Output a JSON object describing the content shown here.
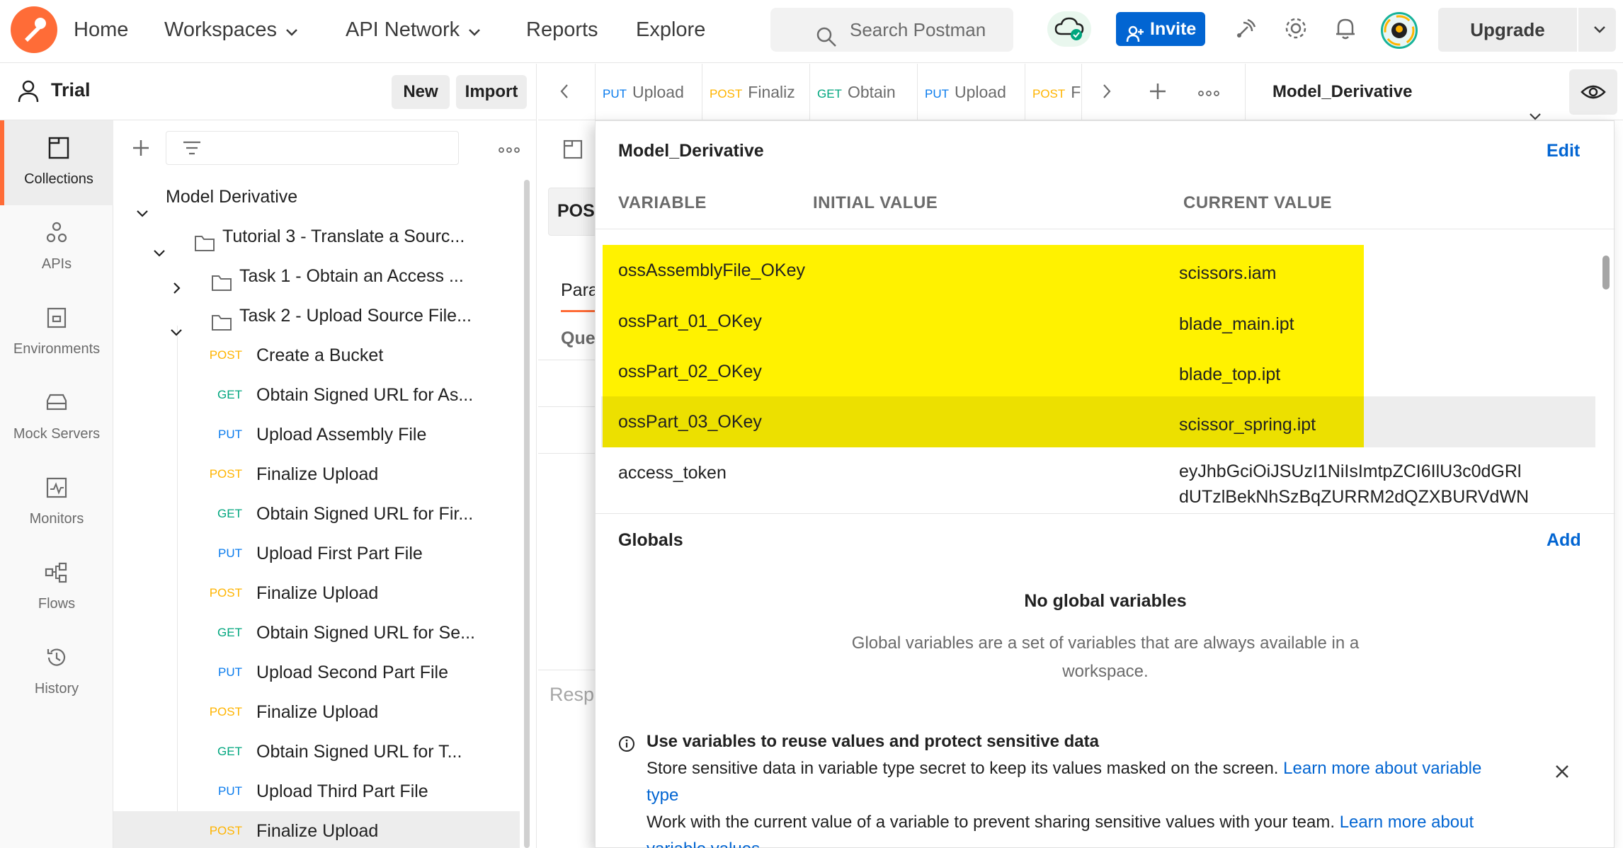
{
  "topbar": {
    "nav": [
      {
        "label": "Home",
        "has_menu": false
      },
      {
        "label": "Workspaces",
        "has_menu": true
      },
      {
        "label": "API Network",
        "has_menu": true
      },
      {
        "label": "Reports",
        "has_menu": false
      },
      {
        "label": "Explore",
        "has_menu": false
      }
    ],
    "search_placeholder": "Search Postman",
    "invite_label": "Invite",
    "upgrade_label": "Upgrade",
    "accent_color": "#ff6c37",
    "primary_color": "#0265d2"
  },
  "workspace": {
    "name": "Trial",
    "new_label": "New",
    "import_label": "Import"
  },
  "rail": [
    {
      "label": "Collections",
      "icon": "collections-icon",
      "active": true
    },
    {
      "label": "APIs",
      "icon": "apis-icon",
      "active": false
    },
    {
      "label": "Environments",
      "icon": "environments-icon",
      "active": false
    },
    {
      "label": "Mock Servers",
      "icon": "mock-servers-icon",
      "active": false
    },
    {
      "label": "Monitors",
      "icon": "monitors-icon",
      "active": false
    },
    {
      "label": "Flows",
      "icon": "flows-icon",
      "active": false
    },
    {
      "label": "History",
      "icon": "history-icon",
      "active": false
    }
  ],
  "tree": {
    "collection": "Model Derivative",
    "folder": "Tutorial 3 - Translate a Sourc...",
    "task1": "Task 1 - Obtain an Access ...",
    "task2": "Task 2 - Upload Source File...",
    "requests": [
      {
        "method": "POST",
        "name": "Create a Bucket"
      },
      {
        "method": "GET",
        "name": "Obtain Signed URL for As..."
      },
      {
        "method": "PUT",
        "name": "Upload Assembly File"
      },
      {
        "method": "POST",
        "name": "Finalize Upload"
      },
      {
        "method": "GET",
        "name": "Obtain Signed URL for Fir..."
      },
      {
        "method": "PUT",
        "name": "Upload First Part File"
      },
      {
        "method": "POST",
        "name": "Finalize Upload"
      },
      {
        "method": "GET",
        "name": "Obtain Signed URL for Se..."
      },
      {
        "method": "PUT",
        "name": "Upload Second Part File"
      },
      {
        "method": "POST",
        "name": "Finalize Upload"
      },
      {
        "method": "GET",
        "name": "Obtain Signed URL for T..."
      },
      {
        "method": "PUT",
        "name": "Upload Third Part File"
      },
      {
        "method": "POST",
        "name": "Finalize Upload"
      }
    ]
  },
  "tabs": [
    {
      "method": "PUT",
      "name": "Upload"
    },
    {
      "method": "POST",
      "name": "Finaliz"
    },
    {
      "method": "GET",
      "name": "Obtain"
    },
    {
      "method": "PUT",
      "name": "Upload"
    },
    {
      "method": "POST",
      "name": "F"
    }
  ],
  "environment": {
    "selected": "Model_Derivative"
  },
  "request_bg": {
    "method_partial": "POS",
    "params_partial": "Para",
    "query_partial": "Que",
    "response_partial": "Resp"
  },
  "popover": {
    "title": "Model_Derivative",
    "edit_label": "Edit",
    "columns": {
      "variable": "VARIABLE",
      "initial": "INITIAL VALUE",
      "current": "CURRENT VALUE"
    },
    "variables": [
      {
        "name": "ossAssemblyFile_OKey",
        "initial": "",
        "current": "scissors.iam"
      },
      {
        "name": "ossPart_01_OKey",
        "initial": "",
        "current": "blade_main.ipt"
      },
      {
        "name": "ossPart_02_OKey",
        "initial": "",
        "current": "blade_top.ipt"
      },
      {
        "name": "ossPart_03_OKey",
        "initial": "",
        "current": "scissor_spring.ipt"
      },
      {
        "name": "access_token",
        "initial": "",
        "current_line1": "eyJhbGciOiJSUzI1NiIsImtpZCI6IlU3c0dGRl",
        "current_line2": "dUTzlBekNhSzBqZURRM2dQZXBURVdWN"
      }
    ],
    "globals_title": "Globals",
    "add_label": "Add",
    "no_globals": "No global variables",
    "globals_desc": "Global variables are a set of variables that are always available in a workspace.",
    "info": {
      "title": "Use variables to reuse values and protect sensitive data",
      "line1": "Store sensitive data in variable type secret to keep its values masked on the screen.",
      "link1": "Learn more about variable",
      "link1b": "type",
      "line2": "Work with the current value of a variable to prevent sharing sensitive values with your team.",
      "link2": "Learn more about",
      "link2b": "variable values"
    },
    "highlight_color": "#fff200"
  }
}
